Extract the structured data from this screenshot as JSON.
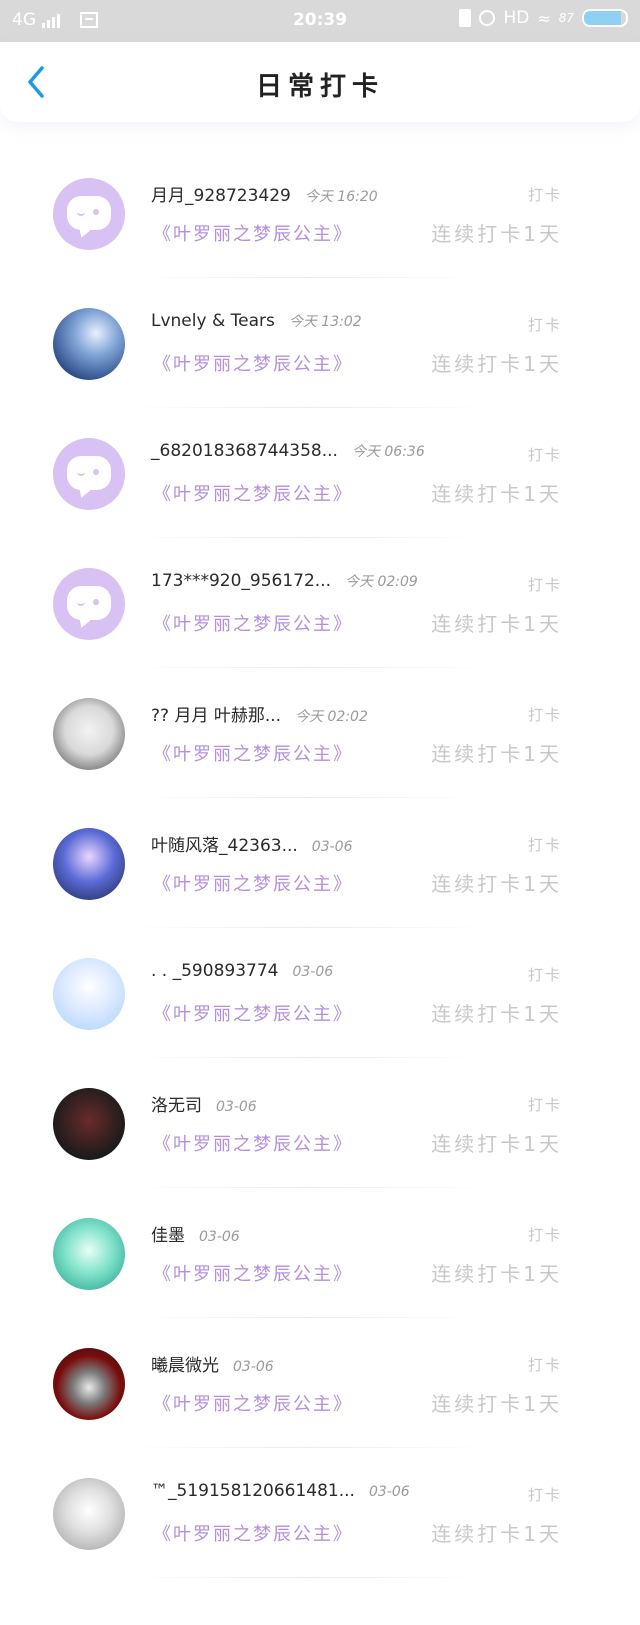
{
  "status_bar": {
    "network": "4G",
    "time": "20:39",
    "hd": "HD",
    "battery_pct": "87",
    "battery_level": 0.87
  },
  "header": {
    "title": "日常打卡"
  },
  "colors": {
    "accent_purple": "#b48fe0",
    "back_blue": "#1a9be8",
    "muted": "#c8c8c8"
  },
  "rows": [
    {
      "name": "月月_928723429",
      "time": "今天 16:20",
      "group": "《叶罗丽之梦辰公主》",
      "tag": "打卡",
      "streak": "连续打卡1天",
      "avatar": "default-avatar"
    },
    {
      "name": "Lvnely & Tears",
      "time": "今天 13:02",
      "group": "《叶罗丽之梦辰公主》",
      "tag": "打卡",
      "streak": "连续打卡1天",
      "avatar": "sea-avatar"
    },
    {
      "name": "_682018368744358...",
      "time": "今天 06:36",
      "group": "《叶罗丽之梦辰公主》",
      "tag": "打卡",
      "streak": "连续打卡1天",
      "avatar": "default-avatar"
    },
    {
      "name": "173***920_956172...",
      "time": "今天 02:09",
      "group": "《叶罗丽之梦辰公主》",
      "tag": "打卡",
      "streak": "连续打卡1天",
      "avatar": "default-avatar"
    },
    {
      "name": "?? 月月 叶赫那...",
      "time": "今天 02:02",
      "group": "《叶罗丽之梦辰公主》",
      "tag": "打卡",
      "streak": "连续打卡1天",
      "avatar": "face-avatar"
    },
    {
      "name": "叶随风落_42363...",
      "time": "03-06",
      "group": "《叶罗丽之梦辰公主》",
      "tag": "打卡",
      "streak": "连续打卡1天",
      "avatar": "doll-avatar"
    },
    {
      "name": ". . _590893774",
      "time": "03-06",
      "group": "《叶罗丽之梦辰公主》",
      "tag": "打卡",
      "streak": "连续打卡1天",
      "avatar": "anime-avatar"
    },
    {
      "name": "洛无司",
      "time": "03-06",
      "group": "《叶罗丽之梦辰公主》",
      "tag": "打卡",
      "streak": "连续打卡1天",
      "avatar": "dark-avatar"
    },
    {
      "name": "佳墨",
      "time": "03-06",
      "group": "《叶罗丽之梦辰公主》",
      "tag": "打卡",
      "streak": "连续打卡1天",
      "avatar": "mint-avatar"
    },
    {
      "name": "曦晨微光",
      "time": "03-06",
      "group": "《叶罗丽之梦辰公主》",
      "tag": "打卡",
      "streak": "连续打卡1天",
      "avatar": "red-avatar"
    },
    {
      "name": "™_519158120661481...",
      "time": "03-06",
      "group": "《叶罗丽之梦辰公主》",
      "tag": "打卡",
      "streak": "连续打卡1天",
      "avatar": "cat-avatar"
    }
  ]
}
